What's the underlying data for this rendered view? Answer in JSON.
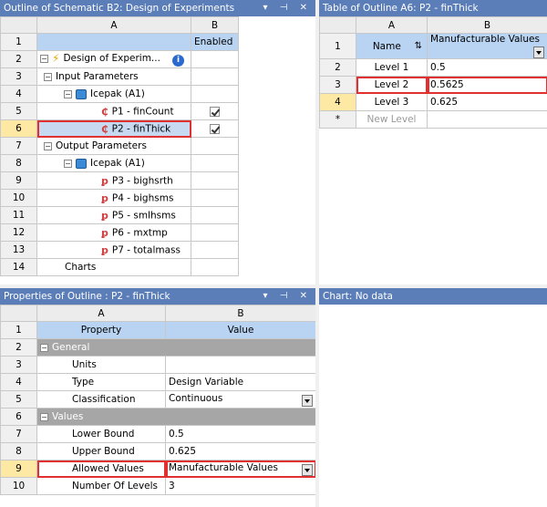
{
  "outline": {
    "title": "Outline of Schematic B2: Design of Experiments",
    "ctrl_pin": "▾ ⊣ ✕",
    "col_a": "A",
    "col_b": "B",
    "enabled_label": "Enabled",
    "rows": [
      {
        "num": "1"
      },
      {
        "num": "2",
        "label": "Design of Experim..."
      },
      {
        "num": "3",
        "label": "Input Parameters"
      },
      {
        "num": "4",
        "label": "Icepak (A1)"
      },
      {
        "num": "5",
        "label": "P1 - finCount"
      },
      {
        "num": "6",
        "label": "P2 - finThick"
      },
      {
        "num": "7",
        "label": "Output Parameters"
      },
      {
        "num": "8",
        "label": "Icepak (A1)"
      },
      {
        "num": "9",
        "label": "P3 - bighsrth"
      },
      {
        "num": "10",
        "label": "P4 - bighsms"
      },
      {
        "num": "11",
        "label": "P5 - smlhsms"
      },
      {
        "num": "12",
        "label": "P6 - mxtmp"
      },
      {
        "num": "13",
        "label": "P7 - totalmass"
      },
      {
        "num": "14",
        "label": "Charts"
      }
    ]
  },
  "table": {
    "title": "Table of Outline A6: P2 - finThick",
    "ctrl_pin": "▾ ⊣ ✕",
    "col_a": "A",
    "col_b": "B",
    "rows": [
      {
        "num": "1",
        "a": "Name",
        "b": "Manufacturable Values"
      },
      {
        "num": "2",
        "a": "Level 1",
        "b": "0.5"
      },
      {
        "num": "3",
        "a": "Level 2",
        "b": "0.5625"
      },
      {
        "num": "4",
        "a": "Level 3",
        "b": "0.625"
      },
      {
        "num": "*",
        "a": "New Level",
        "b": ""
      }
    ]
  },
  "properties": {
    "title": "Properties of Outline : P2 - finThick",
    "ctrl_pin": "▾ ⊣ ✕",
    "col_a": "A",
    "col_b": "B",
    "rows": [
      {
        "num": "1",
        "a": "Property",
        "b": "Value"
      },
      {
        "num": "2",
        "a": "General",
        "b": ""
      },
      {
        "num": "3",
        "a": "Units",
        "b": ""
      },
      {
        "num": "4",
        "a": "Type",
        "b": "Design Variable"
      },
      {
        "num": "5",
        "a": "Classification",
        "b": "Continuous"
      },
      {
        "num": "6",
        "a": "Values",
        "b": ""
      },
      {
        "num": "7",
        "a": "Lower Bound",
        "b": "0.5"
      },
      {
        "num": "8",
        "a": "Upper Bound",
        "b": "0.625"
      },
      {
        "num": "9",
        "a": "Allowed Values",
        "b": "Manufacturable Values"
      },
      {
        "num": "10",
        "a": "Number Of Levels",
        "b": "3"
      }
    ]
  },
  "chart": {
    "title": "Chart: No data"
  }
}
